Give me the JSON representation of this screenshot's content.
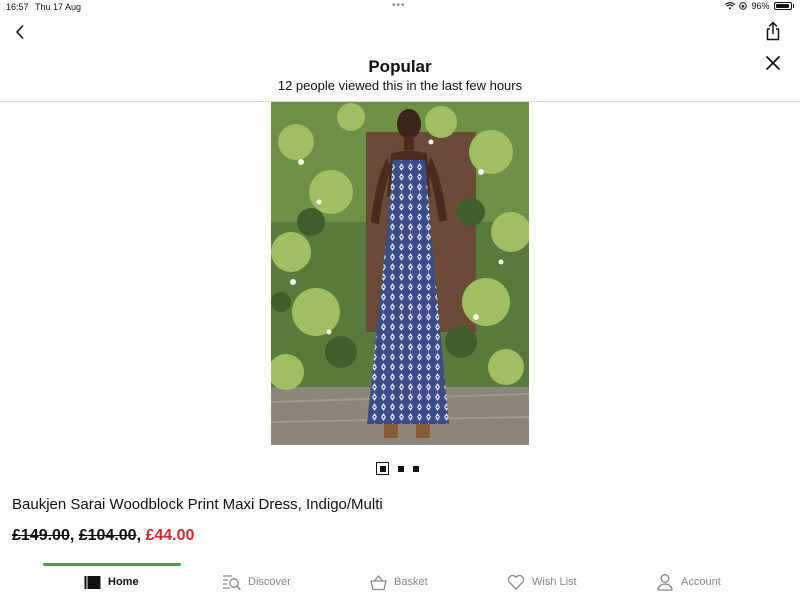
{
  "status_bar": {
    "time": "16:57",
    "date": "Thu 17 Aug",
    "multitask_dots": "•••",
    "battery": "96%",
    "battery_fill_fraction": 0.96
  },
  "header": {
    "title": "Popular",
    "subtitle": "12 people viewed this in the last few hours"
  },
  "gallery": {
    "page_count": 3,
    "current_page": 1
  },
  "product": {
    "name": "Baukjen Sarai Woodblock Print Maxi Dress, Indigo/Multi",
    "price_original": "£149.00",
    "price_previous": "£104.00",
    "price_current": "£44.00",
    "separator": ", "
  },
  "tabs": [
    {
      "label": "Home",
      "icon": "home-icon",
      "active": true
    },
    {
      "label": "Discover",
      "icon": "discover-icon",
      "active": false
    },
    {
      "label": "Basket",
      "icon": "basket-icon",
      "active": false
    },
    {
      "label": "Wish List",
      "icon": "heart-icon",
      "active": false
    },
    {
      "label": "Account",
      "icon": "account-icon",
      "active": false
    }
  ],
  "colors": {
    "accent_green": "#3aa84a",
    "sale_red": "#d22a2a",
    "text": "#111111",
    "muted": "#888888"
  }
}
